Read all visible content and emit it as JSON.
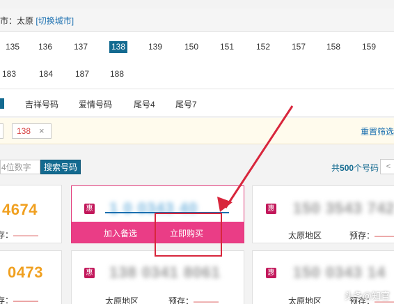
{
  "city_bar": {
    "label": "市：太原",
    "switch_link": "[切换城市]"
  },
  "prefixes": {
    "row1": [
      "135",
      "136",
      "137",
      "138",
      "139",
      "150",
      "151",
      "152",
      "157",
      "158",
      "159"
    ],
    "row2": [
      "183",
      "184",
      "187",
      "188"
    ],
    "selected": "138"
  },
  "tabs": [
    "吉祥号码",
    "爱情号码",
    "尾号4",
    "尾号7"
  ],
  "filter": {
    "tag_value": "138",
    "tag_close": "×",
    "reset_label": "重置筛选"
  },
  "search": {
    "placeholder": "4位数字",
    "button_label": "搜索号码",
    "count_prefix": "共",
    "count_value": "500",
    "count_suffix": "个号码",
    "prev_label": "<"
  },
  "cards": [
    {
      "number_tail": "4674",
      "reserve_label": "存：",
      "reserve_value": "———"
    },
    {
      "badge": "惠",
      "number_blurred": "1 0 0343 40",
      "add_label": "加入备选",
      "buy_label": "立即购买"
    },
    {
      "badge": "惠",
      "number_blurred": "150 3543 742",
      "region": "太原地区",
      "reserve_label": "预存：",
      "reserve_value": "———"
    },
    {
      "number_tail": "0473",
      "reserve_label": "存：",
      "reserve_value": "———"
    },
    {
      "badge": "惠",
      "number_blurred": "138 0341 8061",
      "region": "太原地区",
      "reserve_label": "预存：",
      "reserve_value": "———"
    },
    {
      "badge": "惠",
      "number_blurred": "150 0343 14",
      "region": "太原地区",
      "reserve_label": "预存：",
      "reserve_value": "———"
    }
  ],
  "watermark": "头条@知官",
  "colors": {
    "primary": "#136a90",
    "accent_pink": "#ea3d86",
    "number_orange": "#f0a020",
    "annotation_red": "#d8263c"
  }
}
